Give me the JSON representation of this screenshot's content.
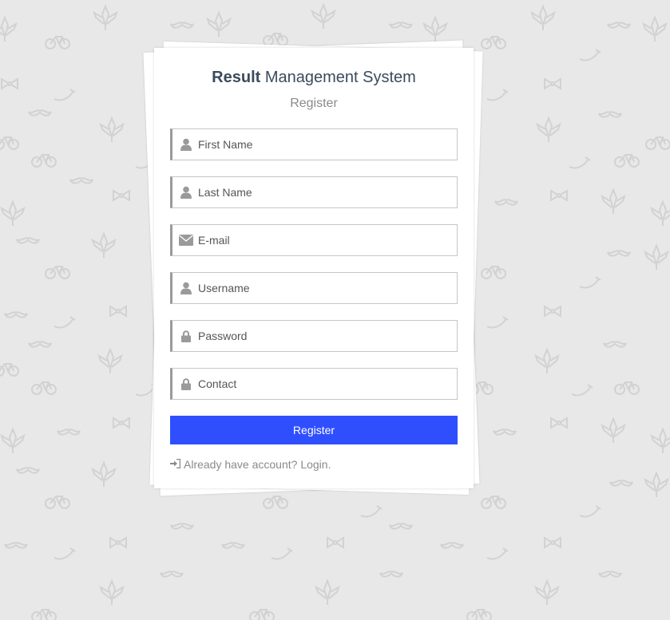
{
  "app": {
    "title_bold": "Result",
    "title_rest": " Management System",
    "subtitle": "Register"
  },
  "form": {
    "fields": [
      {
        "placeholder": "First Name",
        "icon": "user-icon"
      },
      {
        "placeholder": "Last Name",
        "icon": "user-icon"
      },
      {
        "placeholder": "E-mail",
        "icon": "envelope-icon"
      },
      {
        "placeholder": "Username",
        "icon": "user-icon"
      },
      {
        "placeholder": "Password",
        "icon": "lock-icon"
      },
      {
        "placeholder": "Contact",
        "icon": "lock-icon"
      }
    ],
    "submit_label": "Register",
    "login_text": "Already have account? Login."
  },
  "colors": {
    "background": "#e8e8e8",
    "button": "#2f4fff",
    "title": "#3b4b5c",
    "muted": "#8a8a8a"
  }
}
